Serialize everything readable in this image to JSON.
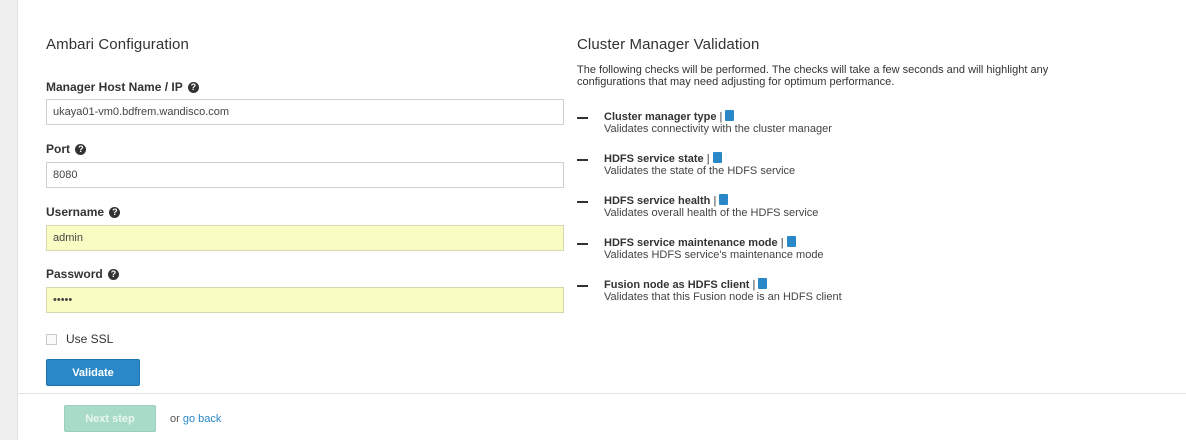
{
  "ambari": {
    "title": "Ambari Configuration",
    "fields": {
      "host": {
        "label": "Manager Host Name / IP",
        "value": "ukaya01-vm0.bdfrem.wandisco.com"
      },
      "port": {
        "label": "Port",
        "value": "8080"
      },
      "username": {
        "label": "Username",
        "value": "admin"
      },
      "password": {
        "label": "Password",
        "value": "•••••"
      }
    },
    "ssl_label": "Use SSL",
    "validate_label": "Validate"
  },
  "validation": {
    "title": "Cluster Manager Validation",
    "intro": "The following checks will be performed. The checks will take a few seconds and will highlight any configurations that may need adjusting for optimum performance.",
    "checks": [
      {
        "name": "Cluster manager type",
        "desc": "Validates connectivity with the cluster manager"
      },
      {
        "name": "HDFS service state",
        "desc": "Validates the state of the HDFS service"
      },
      {
        "name": "HDFS service health",
        "desc": "Validates overall health of the HDFS service"
      },
      {
        "name": "HDFS service maintenance mode",
        "desc": "Validates HDFS service's maintenance mode"
      },
      {
        "name": "Fusion node as HDFS client",
        "desc": "Validates that this Fusion node is an HDFS client"
      }
    ]
  },
  "footer": {
    "next_label": "Next step",
    "or_text": "or",
    "back_label": "go back"
  },
  "icons": {
    "help": "question-circle-icon",
    "doc": "document-icon",
    "dash": "dash-icon"
  },
  "colors": {
    "primary": "#2a88c8",
    "next_disabled": "#a8dcc8",
    "autofill": "#fafdc3"
  }
}
